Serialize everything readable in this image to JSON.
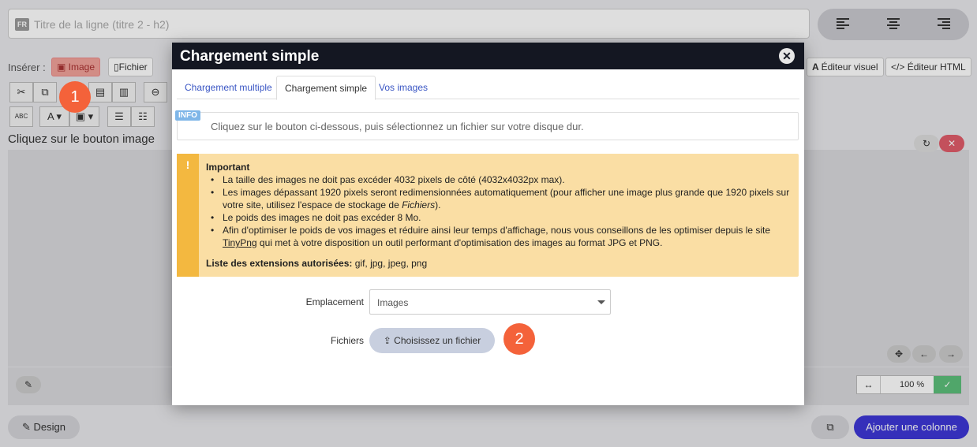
{
  "editor": {
    "title_lang": "FR",
    "title_placeholder": "Titre de la ligne (titre 2 - h2)",
    "insert_label": "Insérer :",
    "insert_image": "Image",
    "insert_file": "Fichier",
    "visual_editor": "Éditeur visuel",
    "html_editor": "Éditeur HTML",
    "body_text": "Cliquez sur le bouton image",
    "design_label": "Design",
    "add_column_label": "Ajouter une colonne",
    "zoom_value": "100 %"
  },
  "modal": {
    "title": "Chargement simple",
    "tabs": [
      {
        "label": "Chargement multiple"
      },
      {
        "label": "Chargement simple"
      },
      {
        "label": "Vos images"
      }
    ],
    "active_tab": "Chargement simple",
    "info_tag": "INFO",
    "info_text": "Cliquez sur le bouton ci-dessous, puis sélectionnez un fichier sur votre disque dur.",
    "warning": {
      "icon": "!",
      "title": "Important",
      "items": [
        "La taille des images ne doit pas excéder 4032 pixels de côté (4032x4032px max).",
        "Les images dépassant 1920 pixels seront redimensionnées automatiquement (pour afficher une image plus grande que 1920 pixels sur votre site, utilisez l'espace de stockage de Fichiers).",
        "Le poids des images ne doit pas excéder 8 Mo.",
        "Afin d'optimiser le poids de vos images et réduire ainsi leur temps d'affichage, nous vous conseillons de les optimiser depuis le site TinyPng qui met à votre disposition un outil performant d'optimisation des images au format JPG et PNG."
      ],
      "extensions_label": "Liste des extensions autorisées:",
      "extensions_value": "gif, jpg, jpeg, png"
    },
    "location_label": "Emplacement",
    "location_value": "Images",
    "files_label": "Fichiers",
    "choose_file_label": "Choisissez un fichier"
  },
  "steps": {
    "one": "1",
    "two": "2"
  },
  "colors": {
    "accent": "#f4623a",
    "header": "#141722",
    "primary_button": "#3d37d6",
    "warning_bg": "#fadea4",
    "warning_strip": "#f3b840"
  }
}
